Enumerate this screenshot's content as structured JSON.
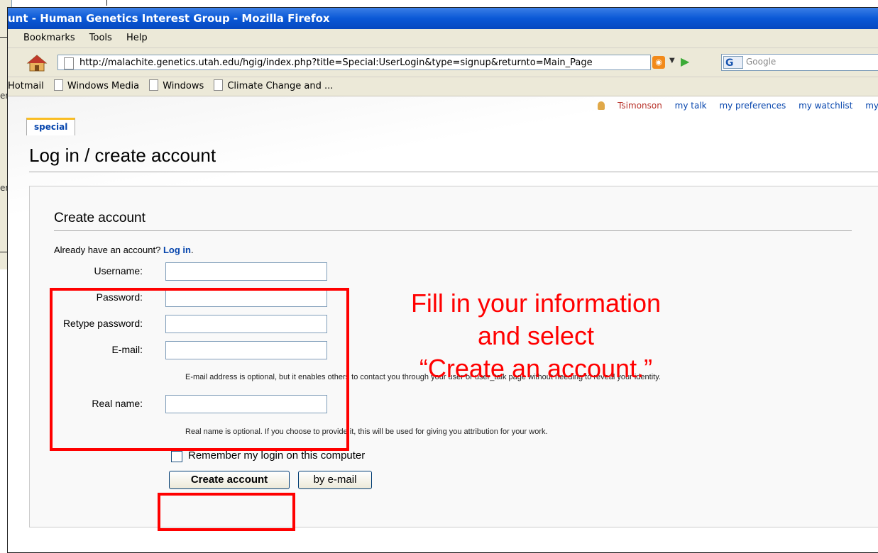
{
  "window": {
    "title": "unt - Human Genetics Interest Group - Mozilla Firefox"
  },
  "background_window": {
    "fragment_1": "er",
    "fragment_2": "er"
  },
  "menu": {
    "items": [
      "Bookmarks",
      "Tools",
      "Help"
    ]
  },
  "navigation": {
    "url": "http://malachite.genetics.utah.edu/hgig/index.php?title=Special:UserLogin&type=signup&returnto=Main_Page",
    "search_placeholder": "Google",
    "search_engine_label": "G"
  },
  "bookmarks": {
    "items": [
      "Hotmail",
      "Windows Media",
      "Windows",
      "Climate Change and ..."
    ]
  },
  "userbar": {
    "username": "Tsimonson",
    "links": [
      "my talk",
      "my preferences",
      "my watchlist",
      "my"
    ]
  },
  "tab": {
    "label": "special"
  },
  "page": {
    "title": "Log in / create account"
  },
  "form": {
    "heading": "Create account",
    "already_text": "Already have an account?",
    "login_link": "Log in",
    "login_suffix": ".",
    "fields": {
      "username_label": "Username:",
      "password_label": "Password:",
      "retype_label": "Retype password:",
      "email_label": "E-mail:",
      "realname_label": "Real name:"
    },
    "email_hint": "E-mail address is optional, but it enables others to contact you through your user or user_talk page without needing to reveal your identity.",
    "realname_hint": "Real name is optional. If you choose to provide it, this will be used for giving you attribution for your work.",
    "remember_label": "Remember my login on this computer",
    "remember_checked": false,
    "create_button": "Create account",
    "email_button": "by e-mail"
  },
  "annotation": {
    "line1": "Fill in your information",
    "line2": "and select",
    "line3": "“Create an account.”"
  },
  "colors": {
    "annotation": "#ff0000",
    "link": "#0645ad",
    "titlebar": "#0a58d6"
  }
}
